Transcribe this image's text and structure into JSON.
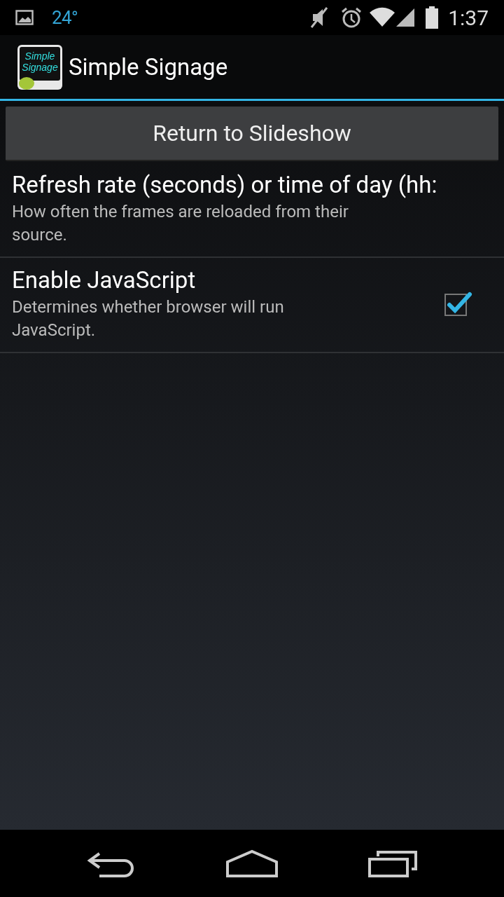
{
  "status_bar": {
    "temperature": "24°",
    "time": "1:37"
  },
  "action_bar": {
    "logo_lines": [
      "Simple",
      "Signage"
    ],
    "title": "Simple Signage"
  },
  "return_button": "Return to Slideshow",
  "preferences": [
    {
      "kind": "text",
      "title": "Refresh rate (seconds) or time of day (hh:",
      "summary": "How often the frames are reloaded from their source."
    },
    {
      "kind": "checkbox",
      "title": "Enable JavaScript",
      "summary": "Determines whether browser will run JavaScript.",
      "checked": true
    }
  ]
}
